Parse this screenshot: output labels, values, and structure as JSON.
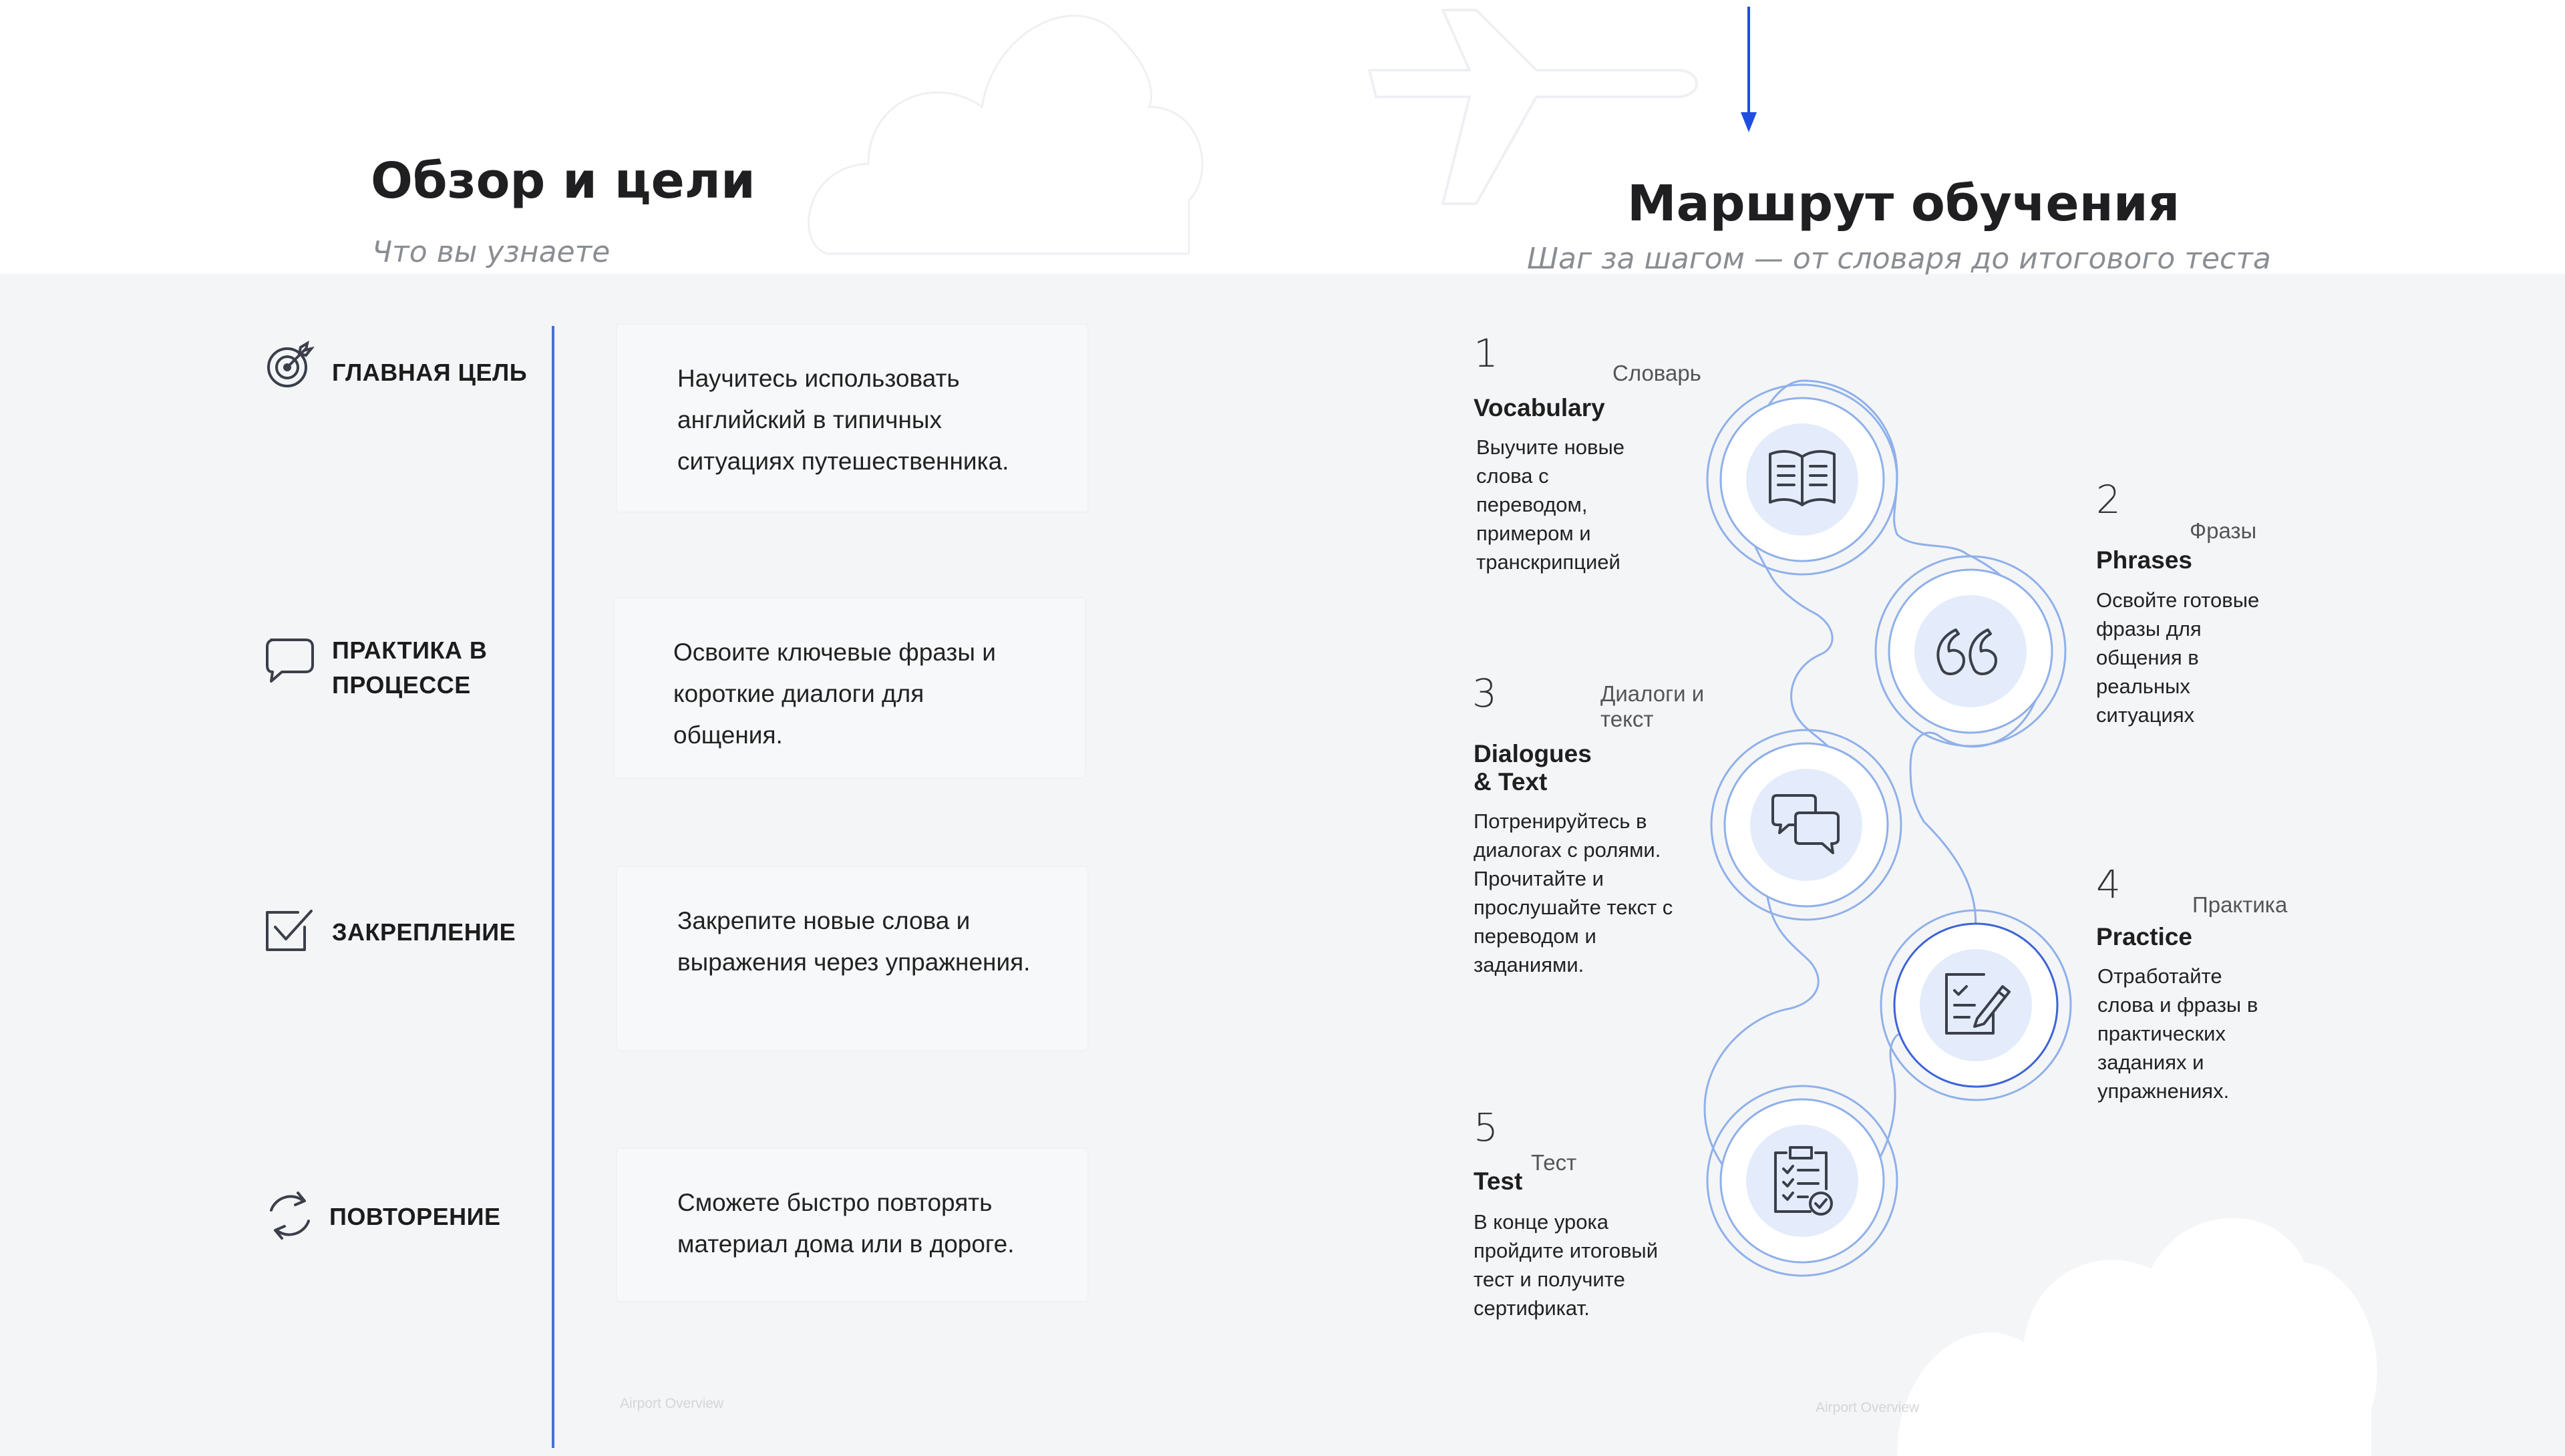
{
  "left": {
    "title": "Обзор и цели",
    "subtitle": "Что вы узнаете",
    "goals": [
      {
        "label": "ГЛАВНАЯ ЦЕЛЬ",
        "text": "Научитесь использовать английский в типичных ситуациях путешественника.",
        "icon": "target-icon"
      },
      {
        "label": "ПРАКТИКА В ПРОЦЕССЕ",
        "text": "Освоите ключевые фразы и короткие диалоги для общения.",
        "icon": "speech-bubble-icon"
      },
      {
        "label": "ЗАКРЕПЛЕНИЕ",
        "text": "Закрепите новые слова и выражения через упражнения.",
        "icon": "checkbox-icon"
      },
      {
        "label": "ПОВТОРЕНИЕ",
        "text": "Сможете быстро повторять материал дома или в дороге.",
        "icon": "refresh-icon"
      }
    ],
    "footer": "Airport Overview"
  },
  "right": {
    "title": "Маршрут обучения",
    "subtitle": "Шаг за шагом — от словаря до итогового теста",
    "steps": [
      {
        "num": "1",
        "ru": "Словарь",
        "en": "Vocabulary",
        "desc": "Выучите новые слова с переводом, примером и транскрипцией",
        "icon": "open-book-icon"
      },
      {
        "num": "2",
        "ru": "Фразы",
        "en": "Phrases",
        "desc": "Освойте готовые фразы для общения в реальных ситуациях",
        "icon": "quote-icon"
      },
      {
        "num": "3",
        "ru": "Диалоги и текст",
        "en": "Dialogues & Text",
        "desc": "Потренируйтесь в диалогах с ролями. Прочитайте и прослушайте текст с переводом и заданиями.",
        "icon": "chat-bubbles-icon"
      },
      {
        "num": "4",
        "ru": "Практика",
        "en": "Practice",
        "desc": "Отработайте слова и фразы в практических заданиях и упражнениях.",
        "icon": "edit-checklist-icon"
      },
      {
        "num": "5",
        "ru": "Тест",
        "en": "Test",
        "desc": "В конце урока пройдите итоговый тест и получите сертификат.",
        "icon": "clipboard-check-icon"
      }
    ],
    "footer": "Airport Overview"
  },
  "colors": {
    "accent": "#1f4fe0",
    "divider": "#4a6fd8",
    "circle_fill": "#e4ecfb",
    "ring": "#8fb0ea",
    "icon": "#3a3f4a"
  }
}
